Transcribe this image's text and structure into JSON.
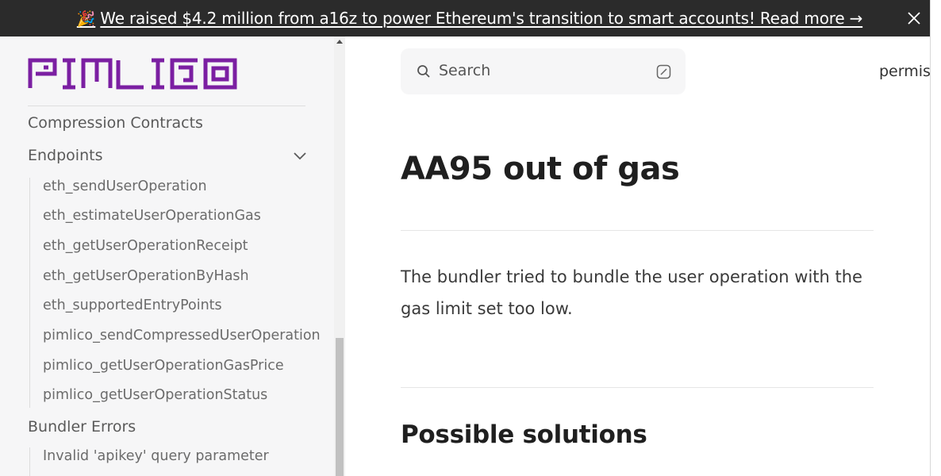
{
  "banner": {
    "emoji": "🎉",
    "text": "We raised $4.2 million from a16z to power Ethereum's transition to smart accounts! Read more →"
  },
  "logo": {
    "text": "PIMLICO",
    "color": "#7b1fa2"
  },
  "sidebar": {
    "compression": "Compression Contracts",
    "endpoints": "Endpoints",
    "endpoint_items": [
      "eth_sendUserOperation",
      "eth_estimateUserOperationGas",
      "eth_getUserOperationReceipt",
      "eth_getUserOperationByHash",
      "eth_supportedEntryPoints",
      "pimlico_sendCompressedUserOperation",
      "pimlico_getUserOperationGasPrice",
      "pimlico_getUserOperationStatus"
    ],
    "bundler_errors": "Bundler Errors",
    "bundler_error_items": [
      "Invalid 'apikey' query parameter"
    ]
  },
  "search": {
    "placeholder": "Search"
  },
  "nav": {
    "top_link": "permis"
  },
  "content": {
    "title": "AA95 out of gas",
    "paragraph": "The bundler tried to bundle the user operation with the gas limit set too low.",
    "section_title": "Possible solutions"
  }
}
